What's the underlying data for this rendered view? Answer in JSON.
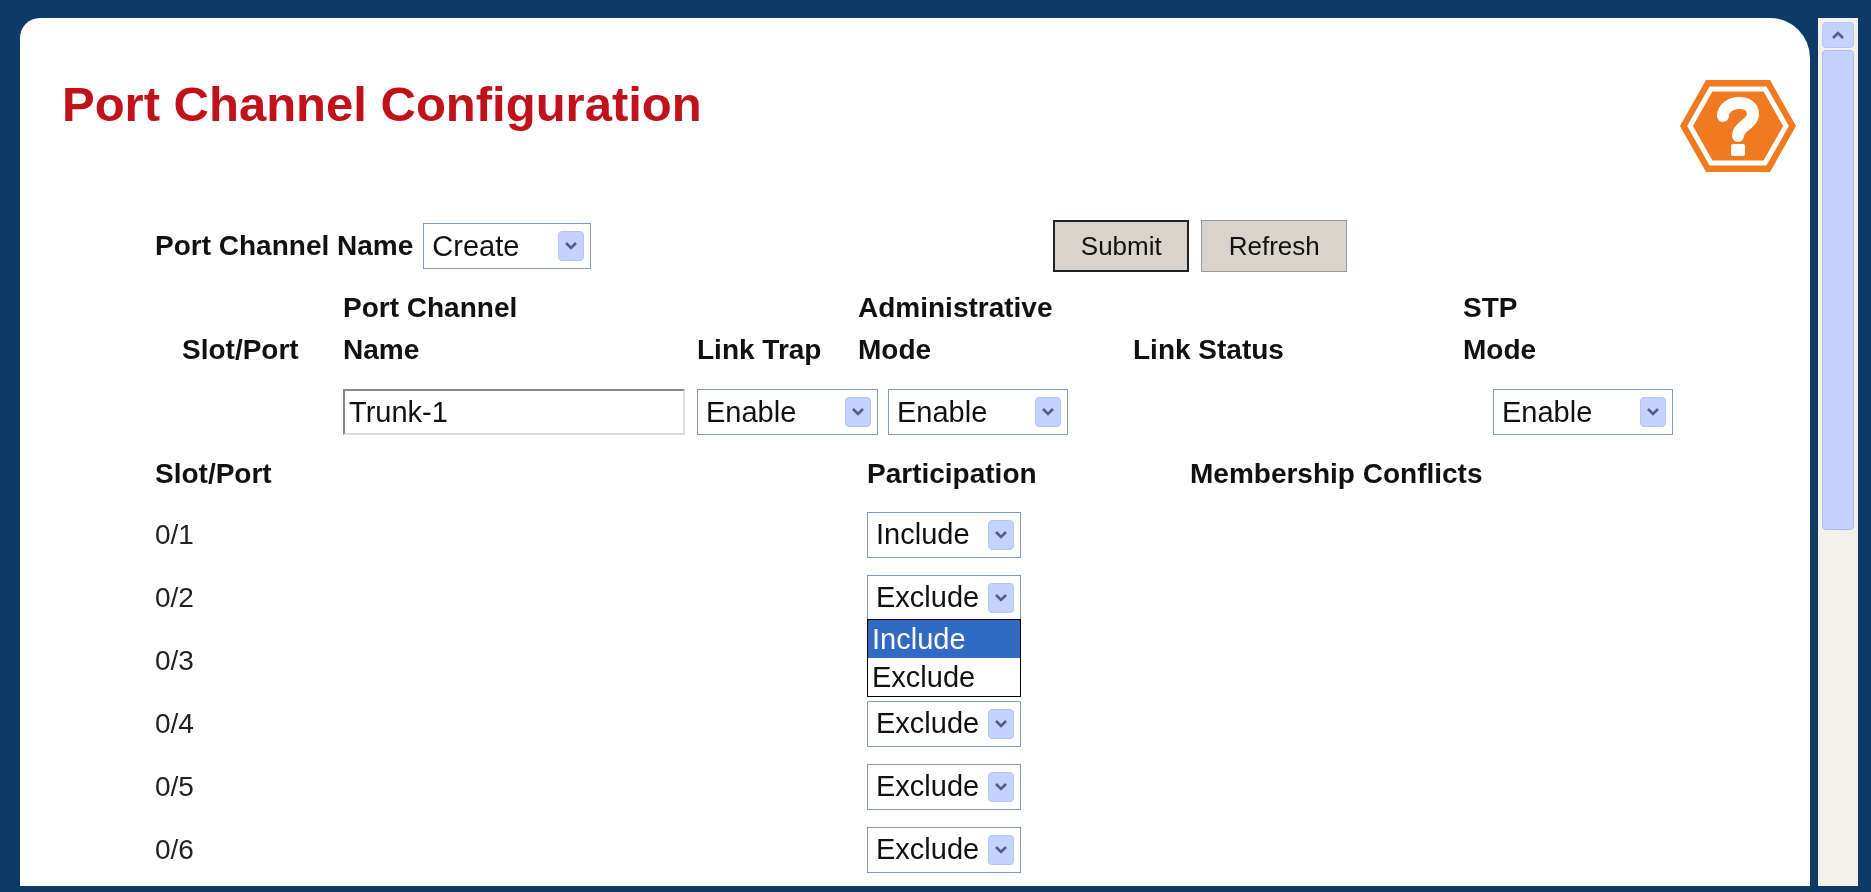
{
  "title": "Port Channel Configuration",
  "port_channel_name": {
    "label": "Port Channel Name",
    "value": "Create"
  },
  "buttons": [
    {
      "label": "Submit",
      "kind": "submit"
    },
    {
      "label": "Refresh",
      "kind": "plain"
    }
  ],
  "config_table": {
    "columns": [
      "Slot/Port",
      "Port Channel\nName",
      "Link Trap",
      "Administrative\nMode",
      "Link Status",
      "STP\nMode"
    ],
    "row": {
      "port_channel_name": "Trunk-1",
      "link_trap": "Enable",
      "administrative_mode": "Enable",
      "stp_mode": "Enable"
    }
  },
  "members_table": {
    "columns": [
      "Slot/Port",
      "Participation",
      "Membership Conflicts"
    ],
    "rows": [
      {
        "slot_port": "0/1",
        "participation": "Include"
      },
      {
        "slot_port": "0/2",
        "participation": "Exclude",
        "open_list": [
          {
            "label": "Include",
            "selected": true
          },
          {
            "label": "Exclude",
            "selected": false
          }
        ]
      },
      {
        "slot_port": "0/3"
      },
      {
        "slot_port": "0/4",
        "participation": "Exclude"
      },
      {
        "slot_port": "0/5",
        "participation": "Exclude"
      },
      {
        "slot_port": "0/6",
        "participation": "Exclude"
      }
    ]
  }
}
